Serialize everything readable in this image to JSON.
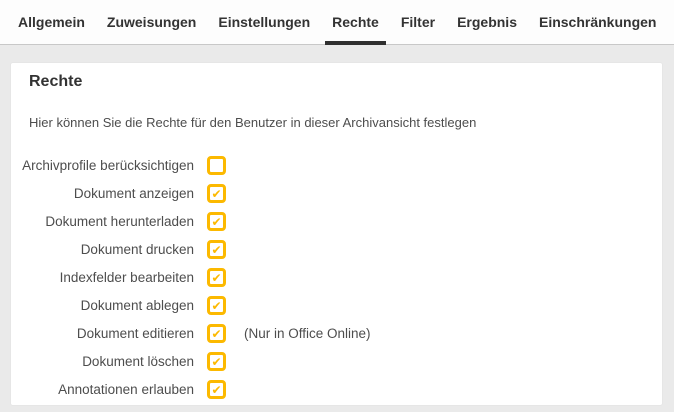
{
  "colors": {
    "accent_yellow": "#fcb900",
    "active_tab_underline": "#2f2f2f",
    "page_background": "#eaeaea",
    "card_background": "#ffffff",
    "text_dark": "#333333",
    "text_gray": "#4d4d4d"
  },
  "tabs": [
    {
      "label": "Allgemein",
      "active": false
    },
    {
      "label": "Zuweisungen",
      "active": false
    },
    {
      "label": "Einstellungen",
      "active": false
    },
    {
      "label": "Rechte",
      "active": true
    },
    {
      "label": "Filter",
      "active": false
    },
    {
      "label": "Ergebnis",
      "active": false
    },
    {
      "label": "Einschränkungen",
      "active": false
    }
  ],
  "panel": {
    "title": "Rechte",
    "description": "Hier können Sie die Rechte für den Benutzer in dieser Archivansicht festlegen",
    "rows": [
      {
        "label": "Archivprofile berücksichtigen",
        "checked": false,
        "note": ""
      },
      {
        "label": "Dokument anzeigen",
        "checked": true,
        "note": ""
      },
      {
        "label": "Dokument herunterladen",
        "checked": true,
        "note": ""
      },
      {
        "label": "Dokument drucken",
        "checked": true,
        "note": ""
      },
      {
        "label": "Indexfelder bearbeiten",
        "checked": true,
        "note": ""
      },
      {
        "label": "Dokument ablegen",
        "checked": true,
        "note": ""
      },
      {
        "label": "Dokument editieren",
        "checked": true,
        "note": "(Nur in Office Online)"
      },
      {
        "label": "Dokument löschen",
        "checked": true,
        "note": ""
      },
      {
        "label": "Annotationen erlauben",
        "checked": true,
        "note": ""
      }
    ]
  }
}
